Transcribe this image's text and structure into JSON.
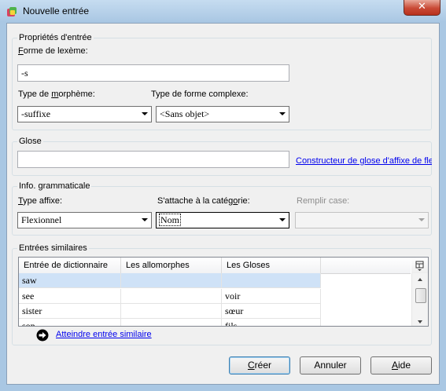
{
  "window": {
    "title": "Nouvelle entrée",
    "close_glyph": "✕"
  },
  "entry_props": {
    "group_label": "Propriétés d'entrée",
    "lexeme_form_label_accel": "F",
    "lexeme_form_label_rest": "orme de lexème:",
    "lexeme_form_value": "-s",
    "morpheme_type_label_pre": "Type de ",
    "morpheme_type_label_accel": "m",
    "morpheme_type_label_rest": "orphème:",
    "morpheme_type_value": "-suffixe",
    "complex_form_type_label": "Type de forme complexe:",
    "complex_form_type_value": "<Sans objet>"
  },
  "gloss": {
    "group_label": "Glose",
    "value": "",
    "builder_link": "Constructeur de glose d'affixe de fle"
  },
  "grammar": {
    "group_label": "Info. grammaticale",
    "affix_type_label_accel": "T",
    "affix_type_label_rest": "ype affixe:",
    "affix_type_value": "Flexionnel",
    "attaches_label_pre": "S'attache à la catég",
    "attaches_label_accel": "o",
    "attaches_label_rest": "rie:",
    "attaches_value": "Nom",
    "fill_slot_label": "Remplir case:",
    "fill_slot_value": ""
  },
  "similar": {
    "group_label": "Entrées similaires",
    "columns": [
      "Entrée de dictionnaire",
      "Les allomorphes",
      "Les Gloses"
    ],
    "rows": [
      [
        "saw",
        "",
        ""
      ],
      [
        "see",
        "",
        "voir"
      ],
      [
        "sister",
        "",
        "sœur"
      ],
      [
        "son",
        "",
        "fils"
      ]
    ],
    "goto_link": "Atteindre entrée similaire"
  },
  "buttons": {
    "create_accel": "C",
    "create_rest": "réer",
    "cancel": "Annuler",
    "help_accel": "A",
    "help_rest": "ide"
  },
  "colors": {
    "link": "#0000ee",
    "selection": "#cfe2f7",
    "title_bar": "#a9c7e3"
  },
  "icons": [
    "app-icon",
    "close-icon",
    "dropdown-arrow-icon",
    "grid-options-icon",
    "arrow-right-circle-icon"
  ]
}
